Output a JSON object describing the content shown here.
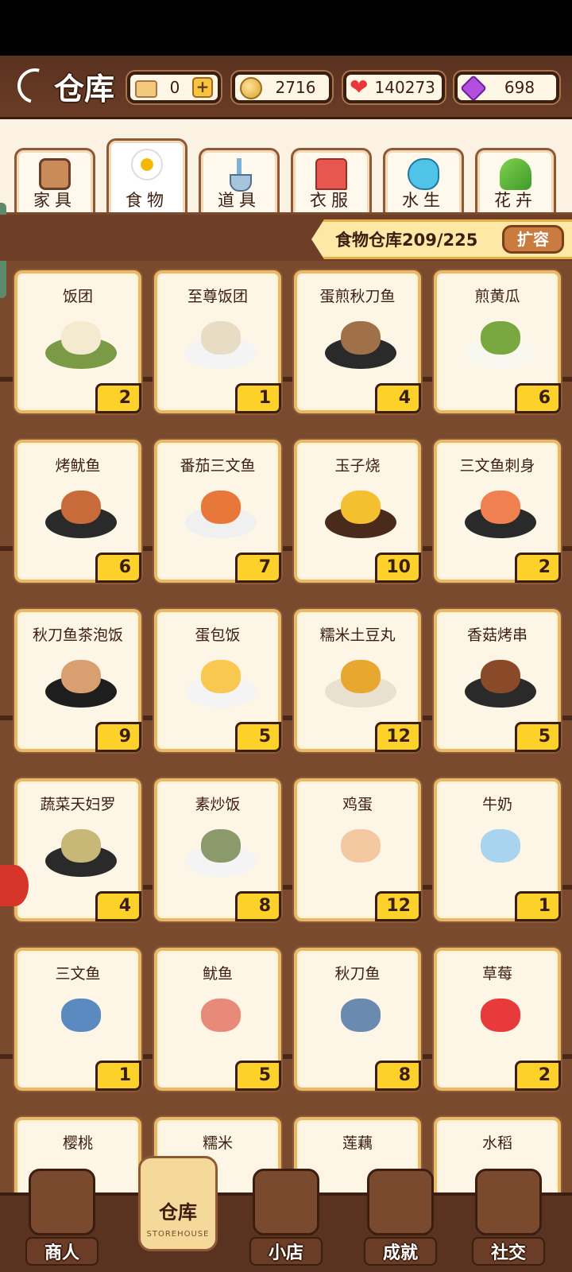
{
  "header": {
    "title": "仓库",
    "resources": [
      {
        "name": "ticket",
        "value": "0",
        "has_plus": true,
        "icon": "ticket-icon"
      },
      {
        "name": "coins",
        "value": "2716",
        "icon": "coin-icon"
      },
      {
        "name": "hearts",
        "value": "140273",
        "icon": "heart-icon"
      },
      {
        "name": "gems",
        "value": "698",
        "icon": "gem-icon"
      }
    ],
    "plus_label": "+"
  },
  "tabs": [
    {
      "label": "家具",
      "icon": "furniture-icon",
      "active": false
    },
    {
      "label": "食物",
      "icon": "egg-icon",
      "active": true
    },
    {
      "label": "道具",
      "icon": "shovel-icon",
      "active": false
    },
    {
      "label": "衣服",
      "icon": "shirt-icon",
      "active": false
    },
    {
      "label": "水生",
      "icon": "fish-icon",
      "active": false
    },
    {
      "label": "花卉",
      "icon": "plant-icon",
      "active": false
    }
  ],
  "capacity": {
    "label": "食物仓库209/225",
    "expand_label": "扩容"
  },
  "items": [
    {
      "name": "饭团",
      "count": "2",
      "plate": "#7a9a46",
      "food": "#f4ead0"
    },
    {
      "name": "至尊饭团",
      "count": "1",
      "plate": "#f4f4f4",
      "food": "#e8dcc4"
    },
    {
      "name": "蛋煎秋刀鱼",
      "count": "4",
      "plate": "#2a2a2a",
      "food": "#a07048"
    },
    {
      "name": "煎黄瓜",
      "count": "6",
      "plate": "#f8f8f0",
      "food": "#7aa840"
    },
    {
      "name": "烤鱿鱼",
      "count": "6",
      "plate": "#2a2a2a",
      "food": "#c86a3a"
    },
    {
      "name": "番茄三文鱼",
      "count": "7",
      "plate": "#f0f0f0",
      "food": "#e8783a"
    },
    {
      "name": "玉子烧",
      "count": "10",
      "plate": "#4a2a1a",
      "food": "#f4c030"
    },
    {
      "name": "三文鱼刺身",
      "count": "2",
      "plate": "#2a2a2a",
      "food": "#f08050"
    },
    {
      "name": "秋刀鱼茶泡饭",
      "count": "9",
      "plate": "#1e1e1e",
      "food": "#d8a070"
    },
    {
      "name": "蛋包饭",
      "count": "5",
      "plate": "#f4f4f4",
      "food": "#f8c850"
    },
    {
      "name": "糯米土豆丸",
      "count": "12",
      "plate": "#e8e0d0",
      "food": "#e8a830"
    },
    {
      "name": "香菇烤串",
      "count": "5",
      "plate": "#2a2a2a",
      "food": "#8a4a2a"
    },
    {
      "name": "蔬菜天妇罗",
      "count": "4",
      "plate": "#2a2a2a",
      "food": "#c8b878"
    },
    {
      "name": "素炒饭",
      "count": "8",
      "plate": "#f4f4f4",
      "food": "#8a9a6a"
    },
    {
      "name": "鸡蛋",
      "count": "12",
      "plate": "transparent",
      "food": "#f4c8a0"
    },
    {
      "name": "牛奶",
      "count": "1",
      "plate": "transparent",
      "food": "#a8d4f0"
    },
    {
      "name": "三文鱼",
      "count": "1",
      "plate": "transparent",
      "food": "#5a8ac0"
    },
    {
      "name": "鱿鱼",
      "count": "5",
      "plate": "transparent",
      "food": "#e88a7a"
    },
    {
      "name": "秋刀鱼",
      "count": "8",
      "plate": "transparent",
      "food": "#6a8ab0"
    },
    {
      "name": "草莓",
      "count": "2",
      "plate": "transparent",
      "food": "#e83a3a"
    },
    {
      "name": "樱桃",
      "count": "",
      "plate": "transparent",
      "food": "transparent"
    },
    {
      "name": "糯米",
      "count": "",
      "plate": "transparent",
      "food": "transparent"
    },
    {
      "name": "莲藕",
      "count": "",
      "plate": "transparent",
      "food": "transparent"
    },
    {
      "name": "水稻",
      "count": "",
      "plate": "transparent",
      "food": "transparent"
    }
  ],
  "nav": [
    {
      "label": "商人",
      "icon": "merchant-icon",
      "active": false
    },
    {
      "label": "仓库",
      "sub": "STOREHOUSE",
      "icon": "storehouse-icon",
      "active": true
    },
    {
      "label": "小店",
      "icon": "shop-icon",
      "active": false
    },
    {
      "label": "成就",
      "icon": "achievement-icon",
      "active": false
    },
    {
      "label": "社交",
      "icon": "social-icon",
      "active": false
    }
  ]
}
